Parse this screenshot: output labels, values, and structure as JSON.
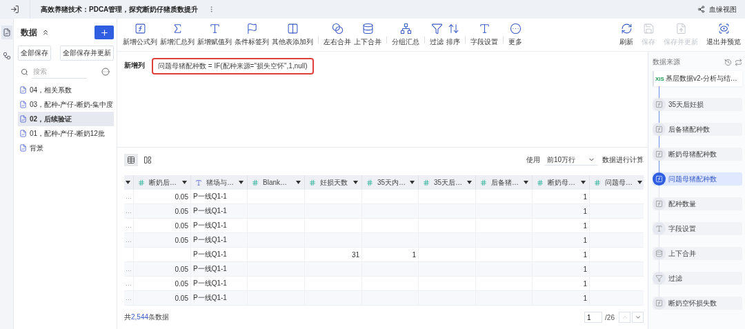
{
  "header": {
    "title": "高效养猪技术：PDCA管理，探究断奶仔猪质数提升",
    "lineage_link": "血缘视图"
  },
  "sidebar": {
    "title": "数据",
    "buttons": [
      "全部保存",
      "全部保存并更新"
    ],
    "search": {
      "placeholder": "搜索"
    },
    "items": [
      {
        "label": "04，相关系数",
        "selected": false
      },
      {
        "label": "03，配种-产仔-断奶-集中度",
        "selected": false
      },
      {
        "label": "02，后续验证",
        "selected": true
      },
      {
        "label": "01，配种-产仔-断奶12批",
        "selected": false
      },
      {
        "label": "背景",
        "selected": false
      }
    ]
  },
  "toolbar": {
    "groups": [
      [
        {
          "kind": "formula",
          "label": "新增公式列"
        },
        {
          "kind": "sum",
          "label": "新增汇总列"
        },
        {
          "kind": "assign",
          "label": "新增赋值列"
        },
        {
          "kind": "flag",
          "label": "条件标签列"
        },
        {
          "kind": "addcol",
          "label": "其他表添加列"
        }
      ],
      [
        {
          "kind": "join",
          "label": "左右合并"
        },
        {
          "kind": "union",
          "label": "上下合并"
        }
      ],
      [
        {
          "kind": "group",
          "label": "分组汇总"
        }
      ],
      [
        {
          "kind": "filter",
          "label": "过滤"
        },
        {
          "kind": "sort",
          "label": "排序"
        }
      ],
      [
        {
          "kind": "field",
          "label": "字段设置"
        }
      ],
      [
        {
          "kind": "more",
          "label": "更多"
        }
      ]
    ],
    "actions": [
      {
        "kind": "refresh",
        "label": "刷新",
        "disabled": false
      },
      {
        "kind": "save",
        "label": "保存",
        "disabled": true
      },
      {
        "kind": "saveupdate",
        "label": "保存并更新",
        "disabled": true
      },
      {
        "kind": "preview",
        "label": "退出并预览",
        "disabled": false
      }
    ]
  },
  "formula": {
    "label": "新增列",
    "expression": "问题母猪配种数 = IF(配种来源=\"损失空怀\",1,null)"
  },
  "table": {
    "use_label": "使用",
    "rows_select": "前10万行",
    "compute_label": "数据进行计算",
    "columns": [
      {
        "kind": "cut"
      },
      {
        "kind": "number",
        "label": "断奶后…"
      },
      {
        "kind": "text",
        "label": "猪场与…"
      },
      {
        "kind": "number",
        "label": "Blank…"
      },
      {
        "kind": "number",
        "label": "妊损天数"
      },
      {
        "kind": "number",
        "label": "35天内…"
      },
      {
        "kind": "number",
        "label": "35天后…"
      },
      {
        "kind": "number",
        "label": "后备猪…"
      },
      {
        "kind": "number",
        "label": "断奶母…"
      },
      {
        "kind": "number",
        "label": "问题母…"
      }
    ],
    "rows": [
      [
        "…",
        "0.05",
        "P一线Q1-1",
        "",
        "",
        "",
        "",
        "",
        "1",
        ""
      ],
      [
        "…",
        "0.05",
        "P一线Q1-1",
        "",
        "",
        "",
        "",
        "",
        "1",
        ""
      ],
      [
        "…",
        "0.05",
        "P一线Q1-1",
        "",
        "",
        "",
        "",
        "",
        "1",
        ""
      ],
      [
        "…",
        "0.05",
        "P一线Q1-1",
        "",
        "",
        "",
        "",
        "",
        "1",
        ""
      ],
      [
        "",
        "",
        "P一线Q1-1",
        "",
        "31",
        "1",
        "",
        "",
        "1",
        ""
      ],
      [
        "…",
        "0.05",
        "P一线Q1-1",
        "",
        "",
        "",
        "",
        "",
        "1",
        ""
      ],
      [
        "…",
        "0.05",
        "P一线Q1-1",
        "",
        "",
        "",
        "",
        "",
        "1",
        ""
      ],
      [
        "…",
        "0.05",
        "P一线Q1-1",
        "",
        "",
        "",
        "",
        "",
        "1",
        ""
      ]
    ],
    "footer_prefix": "共",
    "total": "2,544",
    "footer_suffix": "条数据",
    "page": "1",
    "pages": "/26"
  },
  "steps_panel": {
    "title": "数据来源",
    "source": {
      "badge": "XlS",
      "label": "基层数据v2-分析与结…"
    },
    "steps": [
      {
        "kind": "formula",
        "label": "35天后妊损",
        "selected": false
      },
      {
        "kind": "formula",
        "label": "后备猪配种数",
        "selected": false
      },
      {
        "kind": "formula",
        "label": "断奶母猪配种数",
        "selected": false
      },
      {
        "kind": "formula",
        "label": "问题母猪配种数",
        "selected": true
      },
      {
        "kind": "formula",
        "label": "配种数量",
        "selected": false
      },
      {
        "kind": "field",
        "label": "字段设置",
        "selected": false
      },
      {
        "kind": "union",
        "label": "上下合并",
        "selected": false
      },
      {
        "kind": "filter",
        "label": "过滤",
        "selected": false
      },
      {
        "kind": "formula",
        "label": "断奶空怀损失数",
        "selected": false
      }
    ]
  }
}
